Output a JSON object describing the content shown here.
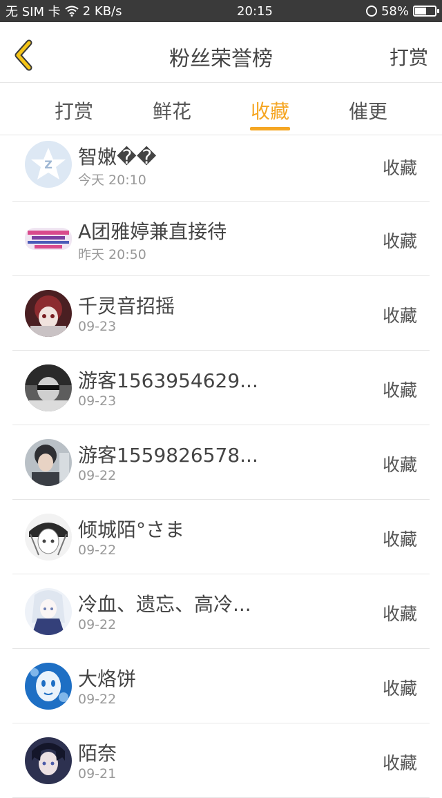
{
  "status_bar": {
    "carrier": "无 SIM 卡",
    "speed": "2 KB/s",
    "time": "20:15",
    "battery": "58%",
    "battery_level": 0.58
  },
  "header": {
    "title": "粉丝荣誉榜",
    "right_link": "打赏"
  },
  "tabs": [
    {
      "label": "打赏",
      "active": false
    },
    {
      "label": "鲜花",
      "active": false
    },
    {
      "label": "收藏",
      "active": true
    },
    {
      "label": "催更",
      "active": false
    }
  ],
  "accent_color": "#f5a623",
  "list": [
    {
      "name": "智嫩��",
      "time": "今天 20:10",
      "action": "收藏",
      "avatar": "qq-star-icon"
    },
    {
      "name": "A团雅婷兼直接待",
      "time": "昨天 20:50",
      "action": "收藏",
      "avatar": "recruit-image"
    },
    {
      "name": "千灵音招摇",
      "time": "09-23",
      "action": "收藏",
      "avatar": "anime-girl-red"
    },
    {
      "name": "游客1563954629...",
      "time": "09-23",
      "action": "收藏",
      "avatar": "guy-with-sunglasses"
    },
    {
      "name": "游客1559826578...",
      "time": "09-22",
      "action": "收藏",
      "avatar": "boy-portrait"
    },
    {
      "name": "倾城陌°さま",
      "time": "09-22",
      "action": "收藏",
      "avatar": "anime-girl-grey"
    },
    {
      "name": "冷血、遗忘、高冷...",
      "time": "09-22",
      "action": "收藏",
      "avatar": "anime-girl-blue"
    },
    {
      "name": "大烙饼",
      "time": "09-22",
      "action": "收藏",
      "avatar": "blue-mask"
    },
    {
      "name": "陌奈",
      "time": "09-21",
      "action": "收藏",
      "avatar": "anime-boy-dark"
    }
  ]
}
